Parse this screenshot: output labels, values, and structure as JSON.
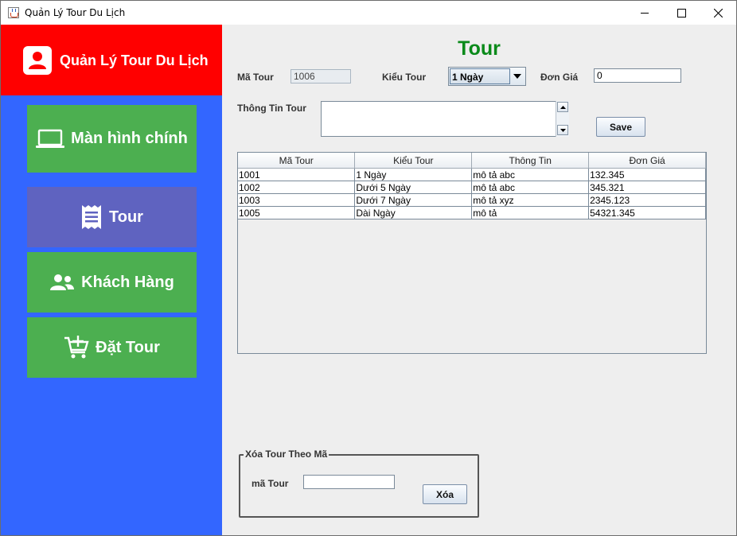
{
  "window": {
    "title": "Quản Lý Tour Du Lịch"
  },
  "sidebar": {
    "header": "Quản Lý Tour Du Lịch",
    "items": [
      {
        "label": "Màn hình chính",
        "icon": "laptop-icon"
      },
      {
        "label": "Tour",
        "icon": "receipt-icon"
      },
      {
        "label": "Khách Hàng",
        "icon": "users-icon"
      },
      {
        "label": "Đặt Tour",
        "icon": "cart-plus-icon"
      }
    ]
  },
  "colors": {
    "sidebar_bg": "#3366ff",
    "header_bg": "#ff0000",
    "nav_green": "#4caf50",
    "nav_active": "#5f63c0",
    "title_green": "#0a8a1a"
  },
  "form": {
    "title": "Tour",
    "ma_tour_label": "Mã Tour",
    "ma_tour_value": "1006",
    "kieu_tour_label": "Kiểu Tour",
    "kieu_tour_value": "1 Ngày",
    "don_gia_label": "Đơn Giá",
    "don_gia_value": "0",
    "thong_tin_label": "Thông Tin Tour",
    "thong_tin_value": "",
    "save_label": "Save"
  },
  "table": {
    "columns": [
      "Mã Tour",
      "Kiểu Tour",
      "Thông Tin",
      "Đơn Giá"
    ],
    "rows": [
      [
        "1001",
        "1 Ngày",
        "mô tả abc",
        "132.345"
      ],
      [
        "1002",
        "Dưới 5 Ngày",
        "mô tả abc",
        "345.321"
      ],
      [
        "1003",
        "Dưới 7 Ngày",
        "mô tả xyz",
        "2345.123"
      ],
      [
        "1005",
        "Dài Ngày",
        "mô tả",
        "54321.345"
      ]
    ]
  },
  "delete": {
    "group_title": "Xóa Tour Theo Mã",
    "label": "mã Tour",
    "value": "",
    "button": "Xóa"
  }
}
